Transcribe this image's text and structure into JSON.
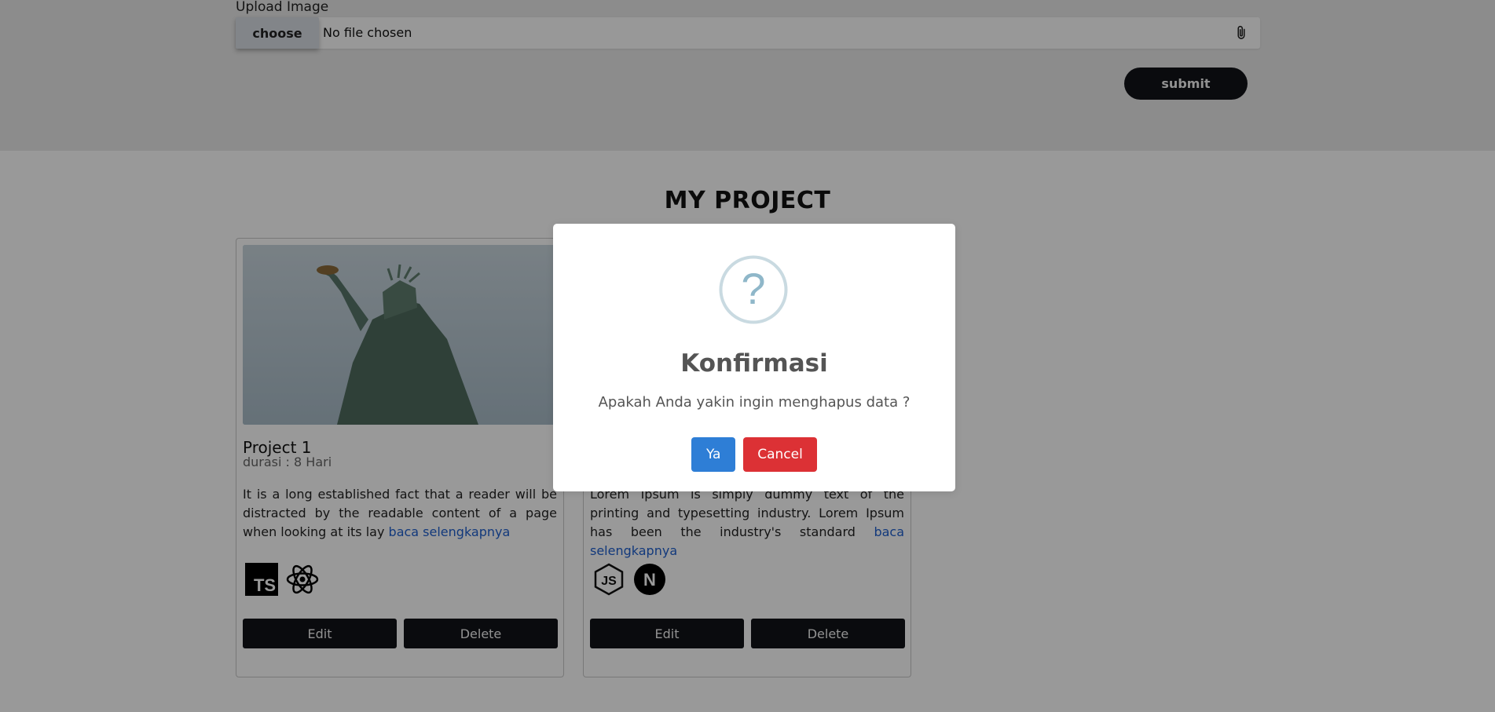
{
  "form": {
    "upload_label": "Upload Image",
    "choose_label": "choose",
    "file_status": "No file chosen",
    "submit_label": "submit"
  },
  "section": {
    "title": "MY PROJECT"
  },
  "projects": [
    {
      "title": "Project 1",
      "duration": "durasi : 8 Hari",
      "description": "It is a long established fact that a reader will be distracted by the readable content of a page when looking at its lay",
      "read_more": "baca selengkapnya",
      "tech_icons": [
        "typescript-icon",
        "react-icon"
      ],
      "tech_text": {
        "ts": "TS"
      },
      "edit_label": "Edit",
      "delete_label": "Delete"
    },
    {
      "description": "Lorem Ipsum is simply dummy text of the printing and typesetting industry. Lorem Ipsum has been the industry's standard",
      "read_more": "baca selengkapnya",
      "tech_icons": [
        "nodejs-icon",
        "nextjs-icon"
      ],
      "tech_text": {
        "js": "JS",
        "n": "N"
      },
      "edit_label": "Edit",
      "delete_label": "Delete"
    }
  ],
  "modal": {
    "icon": "question-icon",
    "icon_text": "?",
    "title": "Konfirmasi",
    "message": "Apakah Anda yakin ingin menghapus data ?",
    "confirm_label": "Ya",
    "cancel_label": "Cancel"
  },
  "colors": {
    "primary_dark": "#111318",
    "confirm_blue": "#2e7ed6",
    "cancel_red": "#dc3135",
    "link_blue": "#1e5fcf",
    "question_icon": "#8fb7c9"
  }
}
